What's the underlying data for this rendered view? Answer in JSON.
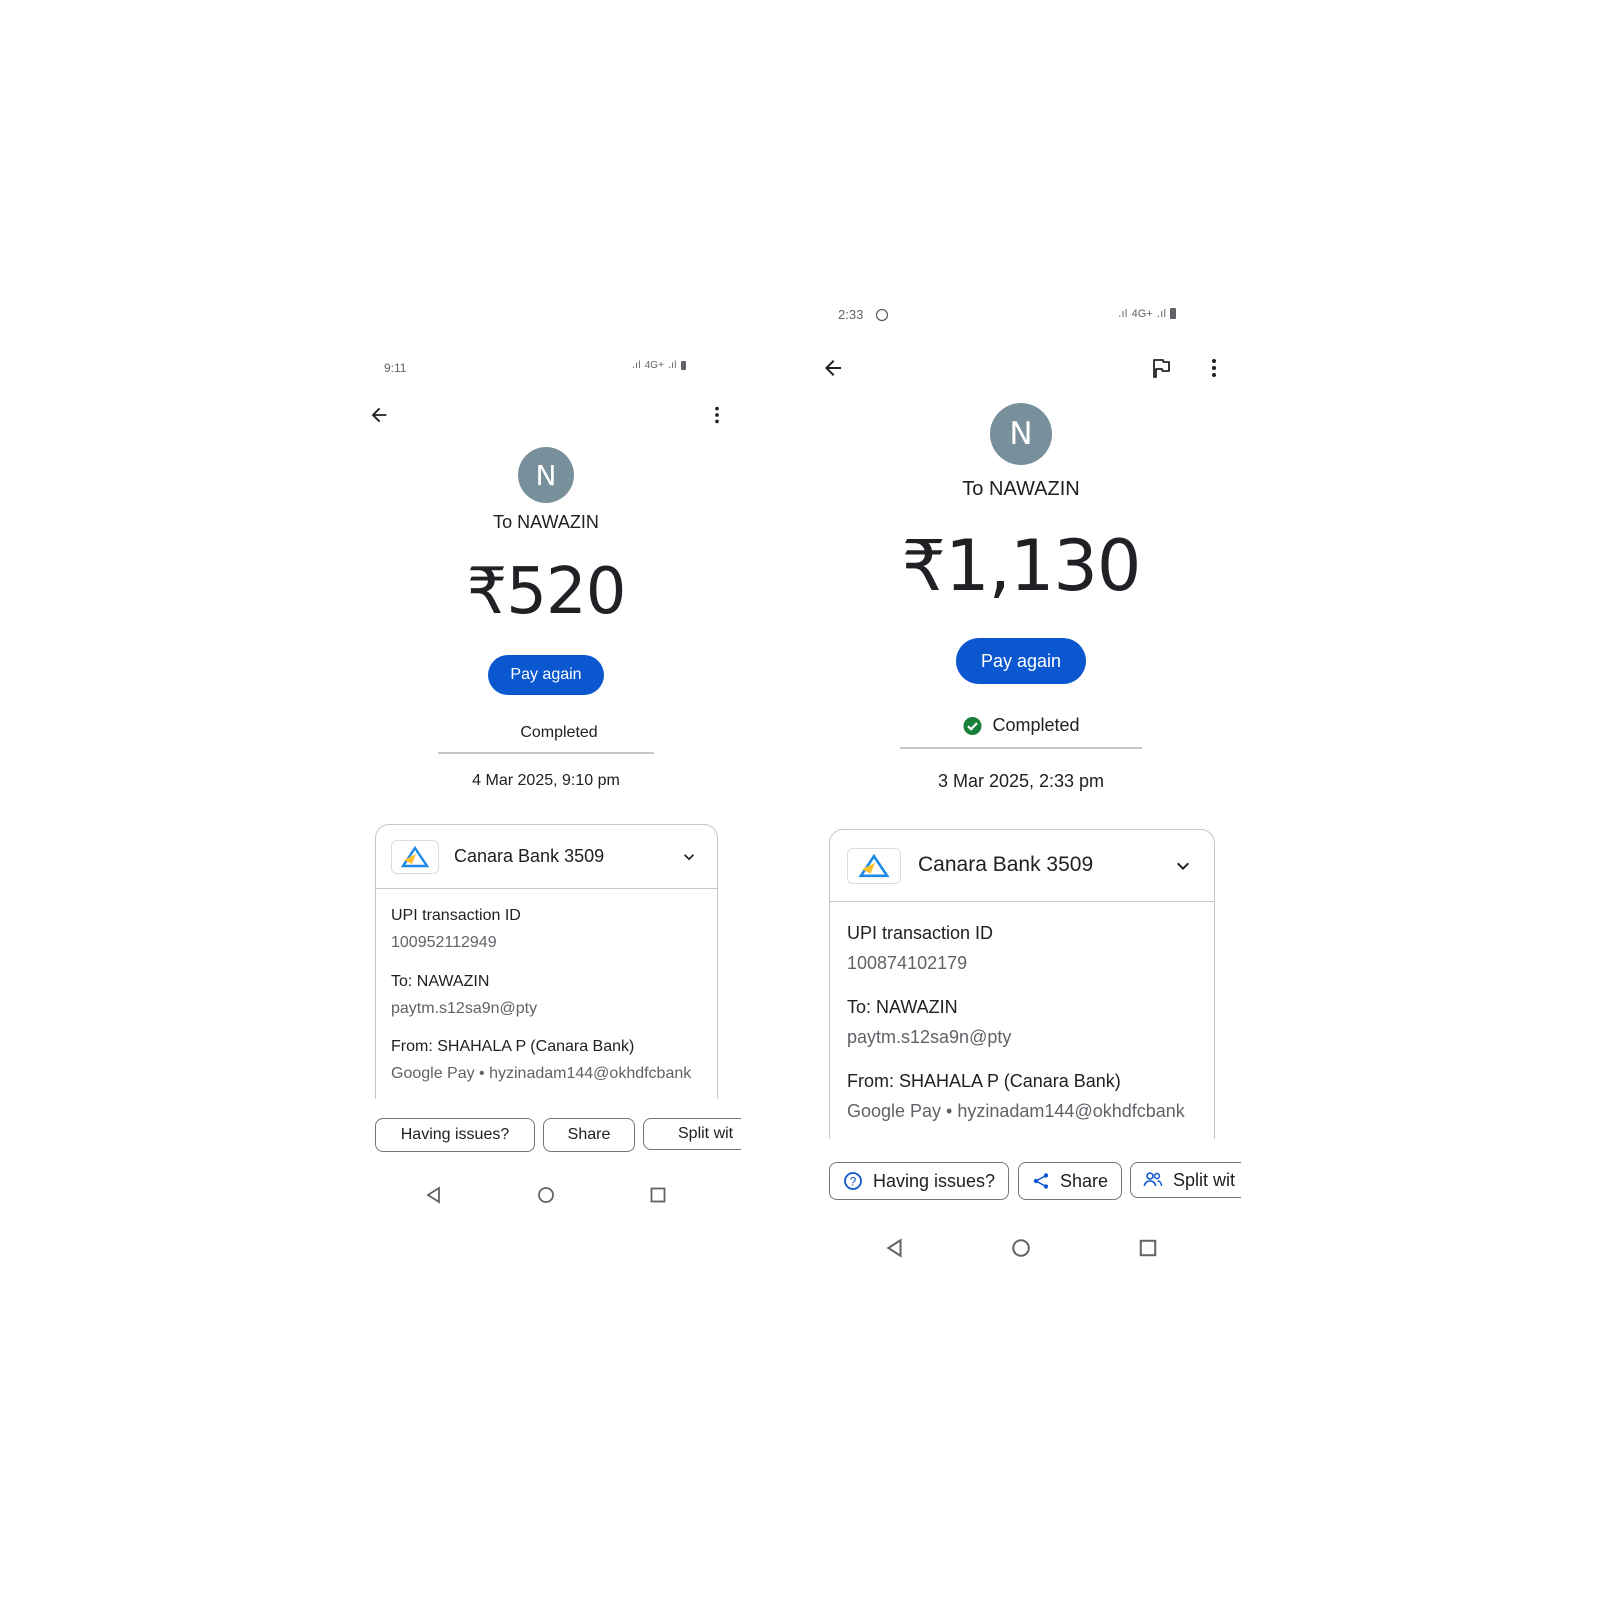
{
  "left": {
    "status_time": "9:11",
    "status_icons": "4G+",
    "avatar_letter": "N",
    "recipient": "To NAWAZIN",
    "amount": "₹520",
    "pay_again": "Pay again",
    "status": "Completed",
    "datetime": "4 Mar 2025, 9:10 pm",
    "bank_account": "Canara Bank 3509",
    "upi_label": "UPI transaction ID",
    "upi_id": "100952112949",
    "to_label": "To: NAWAZIN",
    "to_vpa": "paytm.s12sa9n@pty",
    "from_label": "From: SHAHALA P (Canara Bank)",
    "from_vpa": "Google Pay • hyzinadam144@okhdfcbank",
    "actions": [
      "Having issues?",
      "Share",
      "Split wit"
    ]
  },
  "right": {
    "status_time": "2:33",
    "status_icons": "4G+",
    "avatar_letter": "N",
    "recipient": "To NAWAZIN",
    "amount": "₹1,130",
    "pay_again": "Pay again",
    "status": "Completed",
    "datetime": "3 Mar 2025, 2:33 pm",
    "bank_account": "Canara Bank 3509",
    "upi_label": "UPI transaction ID",
    "upi_id": "100874102179",
    "to_label": "To: NAWAZIN",
    "to_vpa": "paytm.s12sa9n@pty",
    "from_label": "From: SHAHALA P (Canara Bank)",
    "from_vpa": "Google Pay • hyzinadam144@okhdfcbank",
    "actions": [
      "Having issues?",
      "Share",
      "Split wit"
    ]
  },
  "colors": {
    "primary": "#0b57d0",
    "success": "#188038",
    "avatar_bg": "#78909c",
    "canara_blue": "#1e88e5",
    "canara_yellow": "#fbc02d"
  },
  "icons": [
    "back-arrow-icon",
    "more-vert-icon",
    "flag-icon",
    "chevron-down-icon",
    "check-circle-icon",
    "help-circle-icon",
    "share-icon",
    "people-icon",
    "nav-back-icon",
    "nav-home-icon",
    "nav-recents-icon",
    "canara-bank-logo"
  ]
}
